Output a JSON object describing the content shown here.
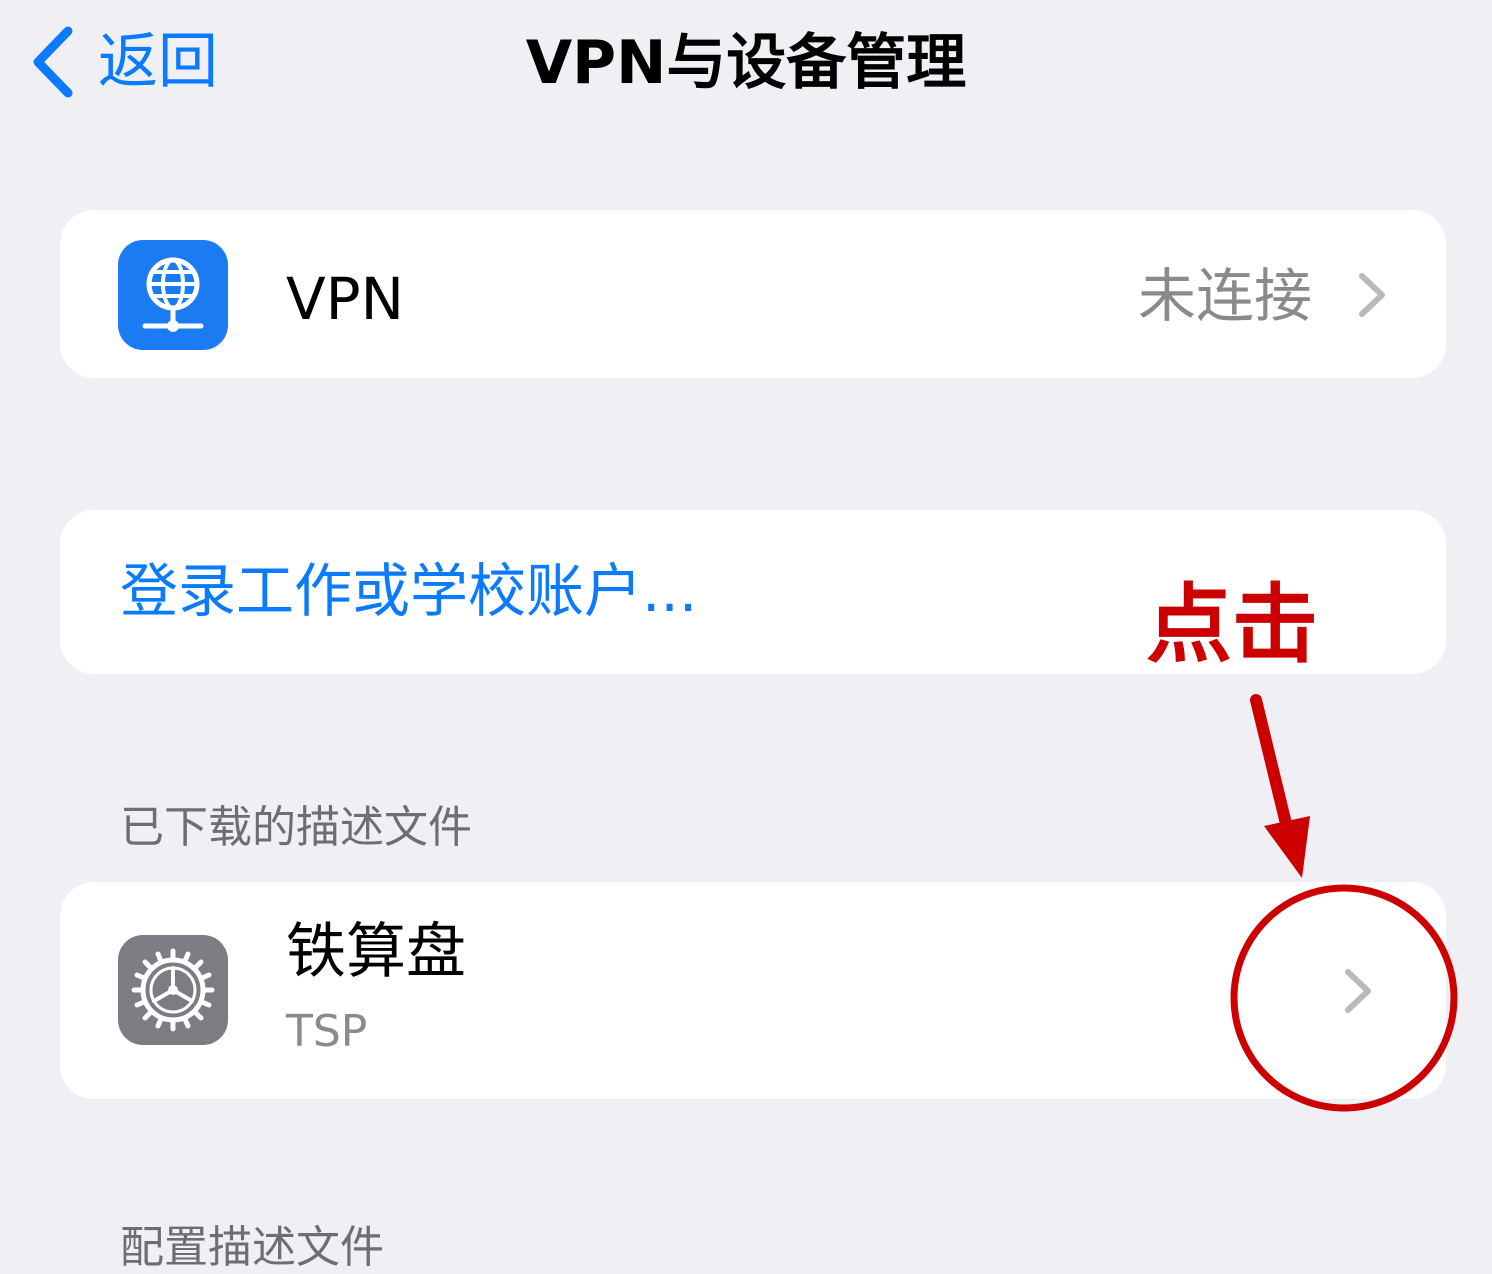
{
  "nav": {
    "back_label": "返回",
    "title": "VPN与设备管理"
  },
  "vpn_row": {
    "label": "VPN",
    "status": "未连接",
    "icon": "globe-network-icon"
  },
  "login_row": {
    "label": "登录工作或学校账户..."
  },
  "downloaded_section": {
    "header": "已下载的描述文件",
    "items": [
      {
        "name": "铁算盘",
        "subtitle": "TSP",
        "icon": "gear-icon"
      }
    ]
  },
  "config_section": {
    "header": "配置描述文件"
  },
  "annotation": {
    "text": "点击",
    "color": "#cc0000"
  },
  "colors": {
    "accent": "#0a7aff",
    "background": "#efeff4",
    "secondary_text": "#8a8a8e",
    "vpn_icon_bg": "#1a7bf3",
    "settings_icon_bg": "#7d7c82"
  }
}
